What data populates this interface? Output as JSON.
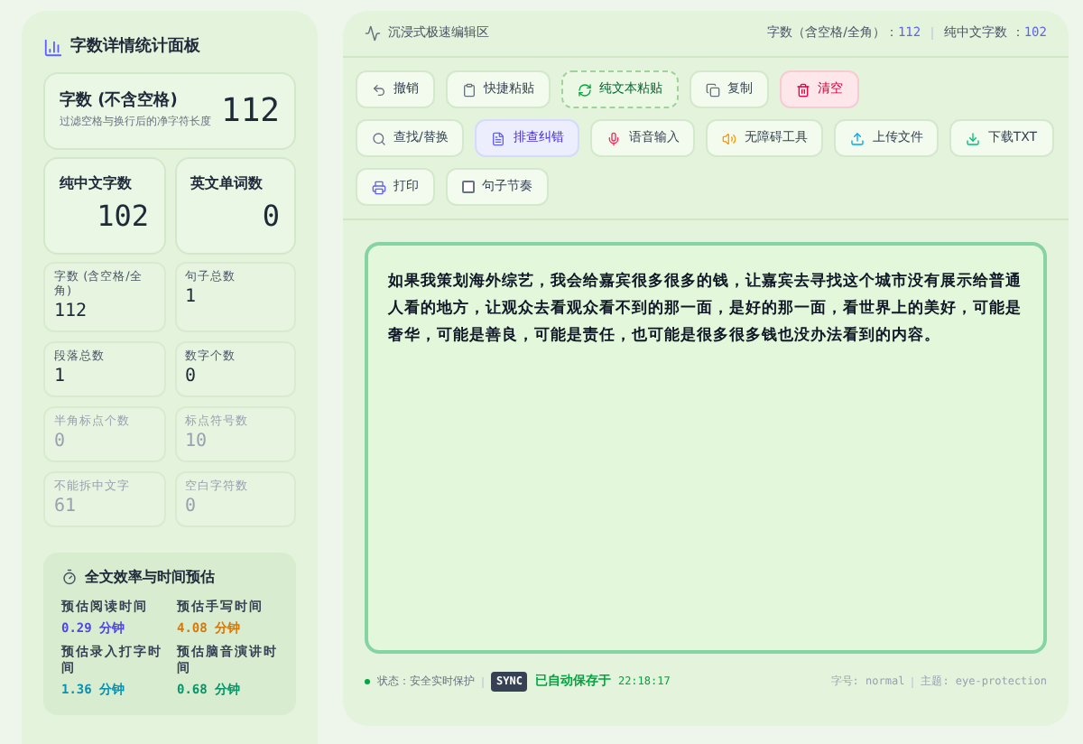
{
  "stats_panel": {
    "title": "字数详情统计面板",
    "main_stat": {
      "label": "字数 (不含空格)",
      "hint": "过滤空格与换行后的净字符长度",
      "value": "112"
    },
    "medium_stats": [
      {
        "label": "纯中文字数",
        "value": "102"
      },
      {
        "label": "英文单词数",
        "value": "0"
      }
    ],
    "small_stats": [
      {
        "label": "字数 (含空格/全角)",
        "value": "112",
        "muted": false
      },
      {
        "label": "句子总数",
        "value": "1",
        "muted": false
      },
      {
        "label": "段落总数",
        "value": "1",
        "muted": false
      },
      {
        "label": "数字个数",
        "value": "0",
        "muted": false
      },
      {
        "label": "半角标点个数",
        "value": "0",
        "muted": true
      },
      {
        "label": "标点符号数",
        "value": "10",
        "muted": true
      },
      {
        "label": "不能拆中文字",
        "value": "61",
        "muted": true
      },
      {
        "label": "空白字符数",
        "value": "0",
        "muted": true
      }
    ],
    "time_card": {
      "title": "全文效率与时间预估",
      "items": [
        {
          "label": "预估阅读时间",
          "value": "0.29",
          "unit": "分钟",
          "color": "#4f46e5"
        },
        {
          "label": "预估手写时间",
          "value": "4.08",
          "unit": "分钟",
          "color": "#d97706"
        },
        {
          "label": "预估录入打字时间",
          "value": "1.36",
          "unit": "分钟",
          "color": "#0891b2"
        },
        {
          "label": "预估脑音演讲时间",
          "value": "0.68",
          "unit": "分钟",
          "color": "#059669"
        }
      ]
    }
  },
  "editor": {
    "title": "沉浸式极速编辑区",
    "counts": [
      {
        "label": "字数（含空格/全角）：",
        "value": "112"
      },
      {
        "label": "纯中文字数 ：",
        "value": "102"
      }
    ],
    "toolbar_rows": [
      [
        {
          "kind": "button",
          "label": "撤销",
          "selected": false
        },
        {
          "kind": "button",
          "label": "快捷粘贴",
          "selected": false
        },
        {
          "kind": "dashed-button",
          "label": "纯文本粘贴",
          "selected": false
        },
        {
          "kind": "button",
          "label": "复制",
          "selected": false
        },
        {
          "kind": "danger-button",
          "label": "清空",
          "selected": false
        }
      ],
      [
        {
          "kind": "button",
          "label": "查找/替换",
          "selected": false
        },
        {
          "kind": "button",
          "label": "排查纠错",
          "selected": true
        },
        {
          "kind": "button",
          "label": "语音输入",
          "selected": false
        },
        {
          "kind": "button",
          "label": "无障碍工具",
          "selected": false
        },
        {
          "kind": "button",
          "label": "上传文件",
          "selected": false
        },
        {
          "kind": "button",
          "label": "下载TXT",
          "selected": false
        }
      ],
      [
        {
          "kind": "button",
          "label": "打印",
          "selected": false
        },
        {
          "kind": "checkbox",
          "label": "句子节奏",
          "checked": false
        }
      ]
    ],
    "text": "如果我策划海外综艺，我会给嘉宾很多很多的钱，让嘉宾去寻找这个城市没有展示给普通人看的地方，让观众去看观众看不到的那一面，是好的那一面，看世界上的美好，可能是奢华，可能是善良，可能是责任，也可能是很多很多钱也没办法看到的内容。",
    "status": {
      "label": "状态：安全实时保护",
      "badge": "SYNC",
      "saved": "已自动保存于",
      "time": "22:18:17",
      "font": "字号: normal",
      "theme": "主题: eye-protection"
    }
  }
}
